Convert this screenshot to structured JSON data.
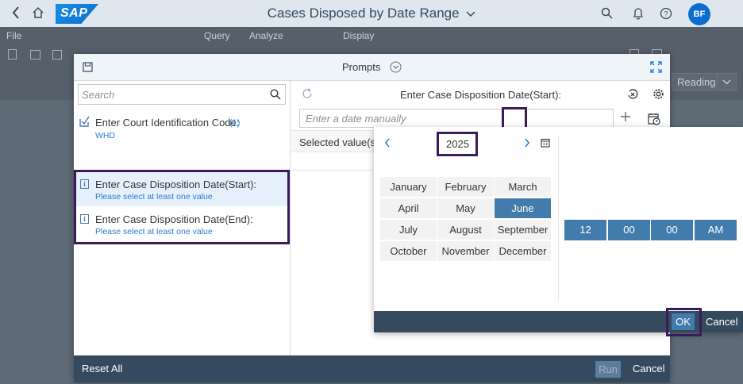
{
  "shell": {
    "title": "Cases Disposed by Date Range",
    "logo_text": "SAP",
    "avatar_initials": "BF"
  },
  "toolbar": {
    "menu_file": "File",
    "group_query": "Query",
    "group_analyze": "Analyze",
    "group_display": "Display",
    "reading_mode": "Reading"
  },
  "dialog": {
    "title": "Prompts",
    "search_placeholder": "Search",
    "prompts": [
      {
        "title": "Enter Court Identification Code:",
        "count": "(1)",
        "sub": "WHD"
      },
      {
        "title": "Enter Case Disposition Date(Start):",
        "sub": "Please select at least one value"
      },
      {
        "title": "Enter Case Disposition Date(End):",
        "sub": "Please select at least one value"
      }
    ],
    "right_title": "Enter Case Disposition Date(Start):",
    "date_placeholder": "Enter a date manually",
    "selected_values_label": "Selected value(s",
    "footer": {
      "reset_all": "Reset All",
      "run": "Run",
      "cancel": "Cancel"
    }
  },
  "picker": {
    "year": "2025",
    "months": [
      "January",
      "February",
      "March",
      "April",
      "May",
      "June",
      "July",
      "August",
      "September",
      "October",
      "November",
      "December"
    ],
    "selected_month": "June",
    "time": {
      "hour": "12",
      "minute": "00",
      "second": "00",
      "ampm": "AM"
    },
    "ok": "OK",
    "cancel": "Cancel"
  },
  "colors": {
    "shell_bg": "#dfe6ee",
    "accent": "#427cac",
    "footer_bg": "#354a5f",
    "highlight_border": "#3b1a5a"
  }
}
